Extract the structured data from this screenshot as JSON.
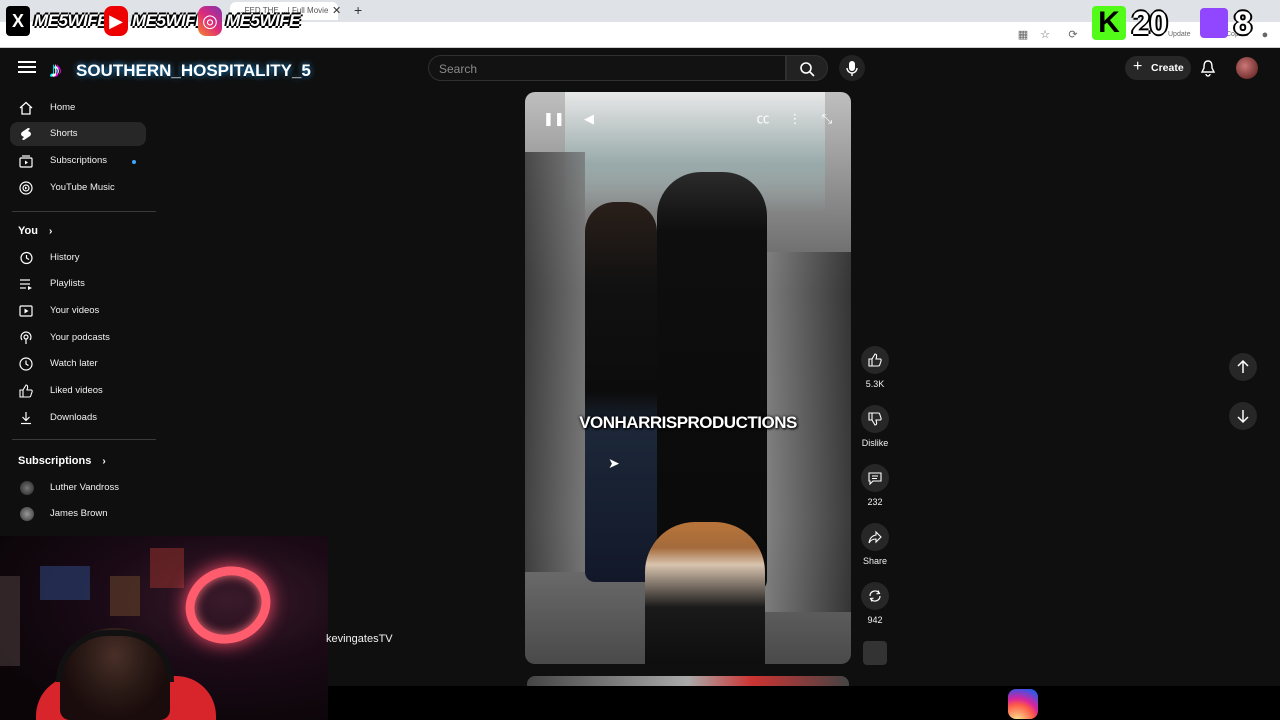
{
  "browser": {
    "tab_title": "...FED THE ...| Full Movie",
    "toolbar_right": [
      "Update",
      "Copilot"
    ]
  },
  "stream_overlay": {
    "socials": [
      {
        "platform": "x-icon",
        "handle": "ME5WIFE"
      },
      {
        "platform": "youtube-icon",
        "handle": "ME5WIFE"
      },
      {
        "platform": "instagram-icon",
        "handle": "ME5WIFE"
      }
    ],
    "tiktok_handle": "SOUTHERN_HOSPITALITY_5",
    "kick_count": "20",
    "twitch_count": "8"
  },
  "header": {
    "search_placeholder": "Search",
    "create_label": "Create"
  },
  "sidebar": {
    "main": [
      {
        "label": "Home",
        "icon": "home-icon"
      },
      {
        "label": "Shorts",
        "icon": "shorts-icon",
        "active": true
      },
      {
        "label": "Subscriptions",
        "icon": "subscriptions-icon"
      },
      {
        "label": "YouTube Music",
        "icon": "youtube-music-icon"
      }
    ],
    "you_title": "You",
    "you": [
      {
        "label": "History",
        "icon": "history-icon"
      },
      {
        "label": "Playlists",
        "icon": "playlists-icon"
      },
      {
        "label": "Your videos",
        "icon": "your-videos-icon"
      },
      {
        "label": "Your podcasts",
        "icon": "podcasts-icon"
      },
      {
        "label": "Watch later",
        "icon": "watch-later-icon"
      },
      {
        "label": "Liked videos",
        "icon": "liked-videos-icon"
      },
      {
        "label": "Downloads",
        "icon": "downloads-icon"
      }
    ],
    "subscriptions_title": "Subscriptions",
    "subscriptions": [
      {
        "label": "Luther Vandross"
      },
      {
        "label": "James Brown"
      }
    ]
  },
  "short": {
    "watermark": "VONHARRISPRODUCTIONS",
    "channel": "kevingatesTV",
    "likes": "5.3K",
    "dislike_label": "Dislike",
    "comments": "232",
    "share_label": "Share",
    "remix": "942"
  },
  "colors": {
    "background": "#0f0f0f",
    "accent_blue": "#3ea6ff",
    "ring_light": "#ff5d6d"
  }
}
